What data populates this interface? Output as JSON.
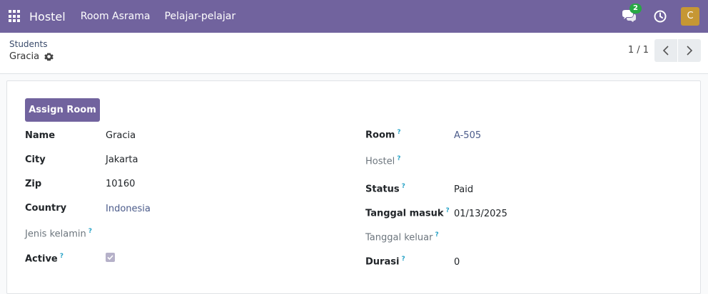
{
  "navbar": {
    "app_name": "Hostel",
    "menus": [
      "Room Asrama",
      "Pelajar-pelajar"
    ],
    "messages_count": "2",
    "user_initial": "C"
  },
  "control": {
    "breadcrumb": "Students",
    "record_name": "Gracia",
    "pager": "1 / 1"
  },
  "form": {
    "assign_button": "Assign Room",
    "left": [
      {
        "label": "Name",
        "value": "Gracia"
      },
      {
        "label": "City",
        "value": "Jakarta"
      },
      {
        "label": "Zip",
        "value": "10160"
      },
      {
        "label": "Country",
        "value": "Indonesia"
      },
      {
        "label": "Jenis kelamin",
        "value": ""
      },
      {
        "label": "Active",
        "value": "checked"
      }
    ],
    "right": [
      {
        "label": "Room",
        "value": "A-505"
      },
      {
        "label": "Hostel",
        "value": ""
      },
      {
        "label": "Status",
        "value": "Paid"
      },
      {
        "label": "Tanggal masuk",
        "value": "01/13/2025"
      },
      {
        "label": "Tanggal keluar",
        "value": ""
      },
      {
        "label": "Durasi",
        "value": "0"
      }
    ],
    "help_mark": "?"
  },
  "colors": {
    "brand": "#71639e",
    "badge": "#28a745",
    "avatar": "#c69734",
    "help": "#29a3c7"
  }
}
